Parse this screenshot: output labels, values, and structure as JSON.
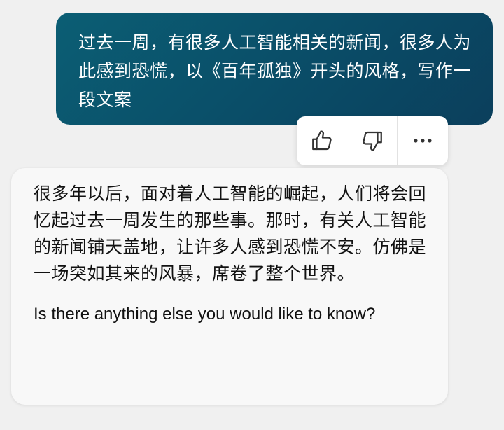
{
  "user_message": {
    "text": "过去一周，有很多人工智能相关的新闻，很多人为此感到恐慌，以《百年孤独》开头的风格，写作一段文案"
  },
  "feedback": {
    "icons": [
      "thumbs-up-icon",
      "thumbs-down-icon",
      "more-options-icon"
    ]
  },
  "bot_message": {
    "text": "很多年以后，面对着人工智能的崛起，人们将会回忆起过去一周发生的那些事。那时，有关人工智能的新闻铺天盖地，让许多人感到恐慌不安。仿佛是一场突如其来的风暴，席卷了整个世界。",
    "followup": "Is there anything else you would like to know?"
  },
  "colors": {
    "user_bubble": "#0a5068",
    "bot_bubble": "#f8f8f8",
    "background": "#f0f0f0",
    "icon": "#333333"
  }
}
